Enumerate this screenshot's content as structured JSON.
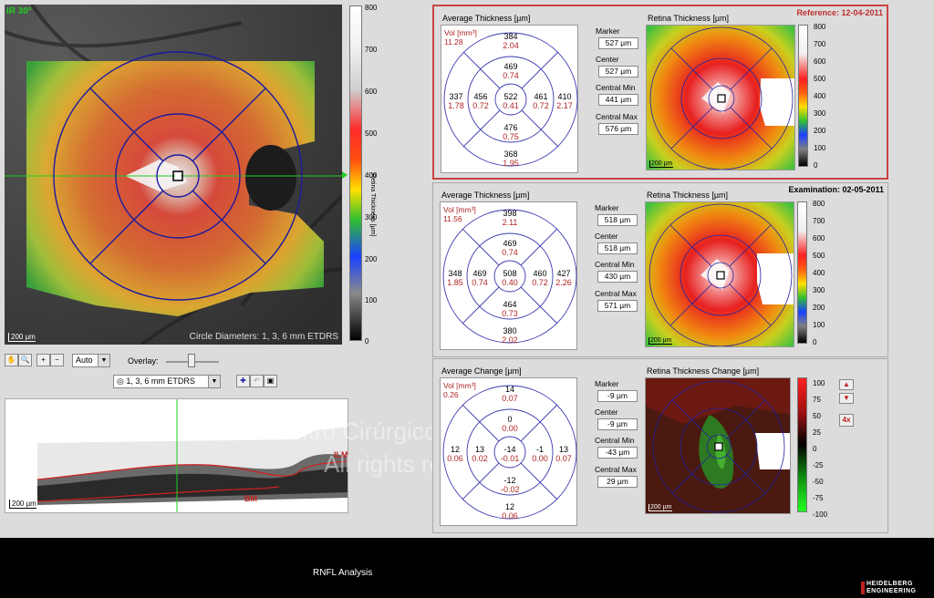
{
  "fundus": {
    "label": "IR 30°",
    "scale_bar": "200 µm",
    "circle_caption": "Circle Diameters: 1, 3, 6 mm ETDRS",
    "scale_title": "Retina Thickness [µm]",
    "scale_ticks": [
      "800",
      "700",
      "600",
      "500",
      "400",
      "300",
      "200",
      "100",
      "0"
    ]
  },
  "toolbar": {
    "zoom_value": "Auto",
    "overlay_label": "Overlay:",
    "grid_select": "1, 3, 6 mm ETDRS"
  },
  "oct": {
    "ilm_label": "ILM",
    "bm_label": "BM",
    "scale_bar": "200 µm"
  },
  "watermark": {
    "line1": "Centro Cirúrgico Oftalmológico de Sorocaba",
    "line2": "All rights reserved"
  },
  "reference": {
    "title": "Reference: 12-04-2011",
    "avg_label": "Average Thickness [µm]",
    "vol_label": "Vol [mm³]",
    "vol_value": "11.28",
    "sectors": {
      "top_outer": [
        "384",
        "2.04"
      ],
      "top_inner": [
        "469",
        "0.74"
      ],
      "left_outer": [
        "337",
        "1.78"
      ],
      "left_inner": [
        "456",
        "0.72"
      ],
      "center": [
        "522",
        "0.41"
      ],
      "right_inner": [
        "461",
        "0.72"
      ],
      "right_outer": [
        "410",
        "2.17"
      ],
      "bottom_inner": [
        "476",
        "0.75"
      ],
      "bottom_outer": [
        "368",
        "1.95"
      ]
    },
    "marker_label": "Marker",
    "marker": "527 µm",
    "center_label": "Center",
    "center": "527 µm",
    "cmin_label": "Central Min",
    "cmin": "441 µm",
    "cmax_label": "Central Max",
    "cmax": "576 µm",
    "map_label": "Retina Thickness [µm]",
    "map_scale": "200 µm",
    "ticks": [
      "800",
      "700",
      "600",
      "500",
      "400",
      "300",
      "200",
      "100",
      "0"
    ]
  },
  "examination": {
    "title": "Examination: 02-05-2011",
    "avg_label": "Average Thickness [µm]",
    "vol_label": "Vol [mm³]",
    "vol_value": "11.56",
    "sectors": {
      "top_outer": [
        "398",
        "2.11"
      ],
      "top_inner": [
        "469",
        "0.74"
      ],
      "left_outer": [
        "348",
        "1.85"
      ],
      "left_inner": [
        "469",
        "0.74"
      ],
      "center": [
        "508",
        "0.40"
      ],
      "right_inner": [
        "460",
        "0.72"
      ],
      "right_outer": [
        "427",
        "2.26"
      ],
      "bottom_inner": [
        "464",
        "0.73"
      ],
      "bottom_outer": [
        "380",
        "2.02"
      ]
    },
    "marker_label": "Marker",
    "marker": "518 µm",
    "center_label": "Center",
    "center": "518 µm",
    "cmin_label": "Central Min",
    "cmin": "430 µm",
    "cmax_label": "Central Max",
    "cmax": "571 µm",
    "map_label": "Retina Thickness [µm]",
    "map_scale": "200 µm",
    "ticks": [
      "800",
      "700",
      "600",
      "500",
      "400",
      "300",
      "200",
      "100",
      "0"
    ]
  },
  "change": {
    "avg_label": "Average Change [µm]",
    "vol_label": "Vol [mm³]",
    "vol_value": "0.26",
    "sectors": {
      "top_outer": [
        "14",
        "0.07"
      ],
      "top_inner": [
        "0",
        "0.00"
      ],
      "left_outer": [
        "12",
        "0.06"
      ],
      "left_inner": [
        "13",
        "0.02"
      ],
      "center": [
        "-14",
        "-0.01"
      ],
      "right_inner": [
        "-1",
        "0.00"
      ],
      "right_outer": [
        "13",
        "0.07"
      ],
      "bottom_inner": [
        "-12",
        "-0.02"
      ],
      "bottom_outer": [
        "12",
        "0.06"
      ]
    },
    "marker_label": "Marker",
    "marker": "-9 µm",
    "center_label": "Center",
    "center": "-9 µm",
    "cmin_label": "Central Min",
    "cmin": "-43 µm",
    "cmax_label": "Central Max",
    "cmax": "29 µm",
    "map_label": "Retina Thickness Change [µm]",
    "map_scale": "200 µm",
    "ticks": [
      "100",
      "75",
      "50",
      "25",
      "0",
      "-25",
      "-50",
      "-75",
      "-100"
    ],
    "zoom_button": "4x"
  },
  "footer": {
    "title": "RNFL Analysis",
    "brand1": "HEIDELBERG",
    "brand2": "ENGINEERING"
  },
  "colors": {
    "reference_border": "#c94444",
    "grid_blue": "#1a1aa0"
  }
}
